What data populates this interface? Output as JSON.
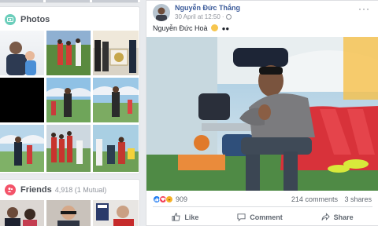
{
  "photos": {
    "title": "Photos"
  },
  "friends": {
    "title": "Friends",
    "count": "4,918 (1 Mutual)"
  },
  "post": {
    "author": "Nguyễn Đức Thắng",
    "date": "30 April at 12:50",
    "caption": "Nguyễn Đức Hoà",
    "reactions_count": "909",
    "comments": "214 comments",
    "shares": "3 shares"
  },
  "actions": {
    "like": "Like",
    "comment": "Comment",
    "share": "Share"
  },
  "icons": {
    "photos": "photos-icon",
    "friends": "friends-icon",
    "globe": "globe-icon",
    "more": "more-options-icon",
    "like": "thumbs-up-icon",
    "love": "heart-icon",
    "haha": "laugh-icon",
    "comment": "speech-bubble-icon",
    "share": "share-arrow-icon"
  },
  "colors": {
    "link": "#385898",
    "photos_icon": "#6bcebb",
    "friends_icon": "#f35369",
    "like_blue": "#1877f2",
    "love_red": "#f33e58",
    "haha_yellow": "#f7b125"
  }
}
